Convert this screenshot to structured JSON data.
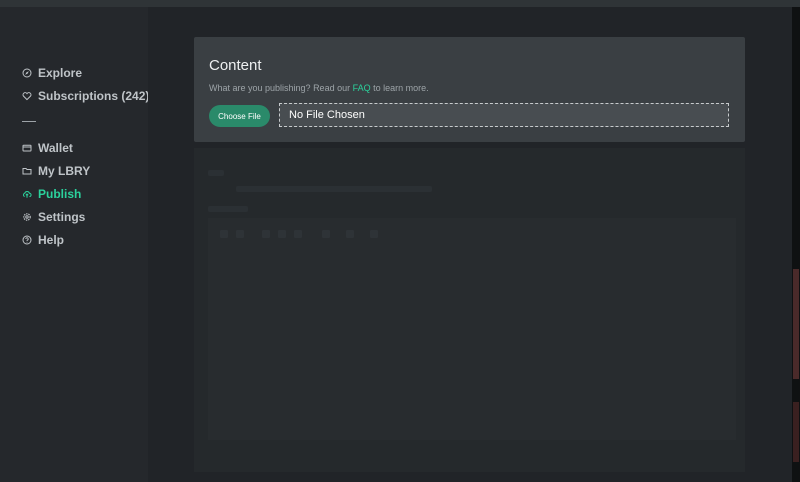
{
  "sidebar": {
    "items": [
      {
        "label": "Explore",
        "icon": "compass-icon"
      },
      {
        "label": "Subscriptions (242)",
        "icon": "heart-icon"
      },
      {
        "label": "Wallet",
        "icon": "wallet-icon"
      },
      {
        "label": "My LBRY",
        "icon": "folder-icon"
      },
      {
        "label": "Publish",
        "icon": "cloud-upload-icon",
        "active": true
      },
      {
        "label": "Settings",
        "icon": "gear-icon"
      },
      {
        "label": "Help",
        "icon": "help-icon"
      }
    ]
  },
  "content_card": {
    "title": "Content",
    "subtitle_prefix": "What are you publishing? Read our ",
    "subtitle_link": "FAQ",
    "subtitle_suffix": " to learn more.",
    "choose_button": "Choose File",
    "file_status": "No File Chosen"
  },
  "colors": {
    "accent": "#2bd19c",
    "button": "#2a8a6a",
    "card": "#3a3f43",
    "background": "#25282c"
  }
}
